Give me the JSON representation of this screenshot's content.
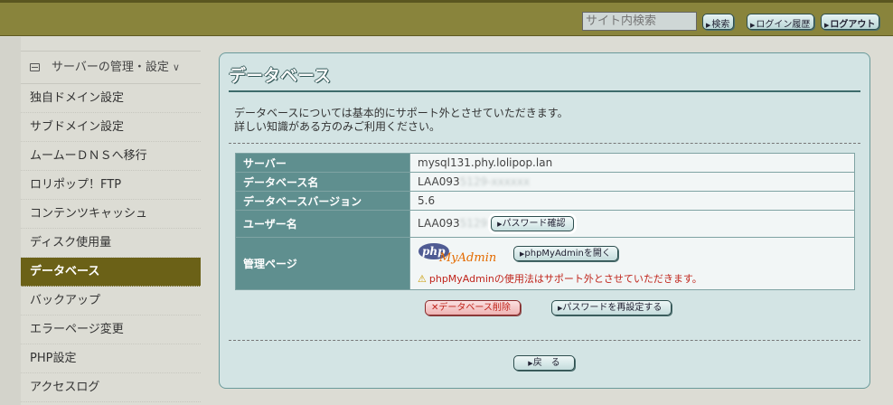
{
  "header": {
    "search_placeholder": "サイト内検索",
    "search_button": "検索",
    "login_history": "ログイン履歴",
    "logout": "ログアウト"
  },
  "sidebar": {
    "group_label": "サーバーの管理・設定",
    "items": [
      {
        "label": "独自ドメイン設定"
      },
      {
        "label": "サブドメイン設定"
      },
      {
        "label": "ムームーＤＮＳへ移行"
      },
      {
        "label": "ロリポップ！FTP"
      },
      {
        "label": "コンテンツキャッシュ"
      },
      {
        "label": "ディスク使用量"
      },
      {
        "label": "データベース",
        "active": true
      },
      {
        "label": "バックアップ"
      },
      {
        "label": "エラーページ変更"
      },
      {
        "label": "PHP設定"
      },
      {
        "label": "アクセスログ"
      }
    ]
  },
  "main": {
    "title": "データベース",
    "notice_line1": "データベースについては基本的にサポート外とさせていただきます。",
    "notice_line2": "詳しい知識がある方のみご利用ください。",
    "rows": {
      "server_label": "サーバー",
      "server_value": "mysql131.phy.lolipop.lan",
      "dbname_label": "データベース名",
      "dbname_value": "LAA093",
      "dbname_masked": "5129-xxxxxx",
      "version_label": "データベースバージョン",
      "version_value": "5.6",
      "user_label": "ユーザー名",
      "user_value": "LAA093",
      "user_masked": "5129",
      "password_check": "パスワード確認",
      "admin_label": "管理ページ",
      "pma_logo_php": "php",
      "pma_logo_my": "MyAdmin",
      "pma_open": "phpMyAdminを開く",
      "pma_warning": "phpMyAdminの使用法はサポート外とさせていただきます。"
    },
    "delete_db": "データベース削除",
    "reset_password": "パスワードを再設定する",
    "back": "戻　る"
  }
}
